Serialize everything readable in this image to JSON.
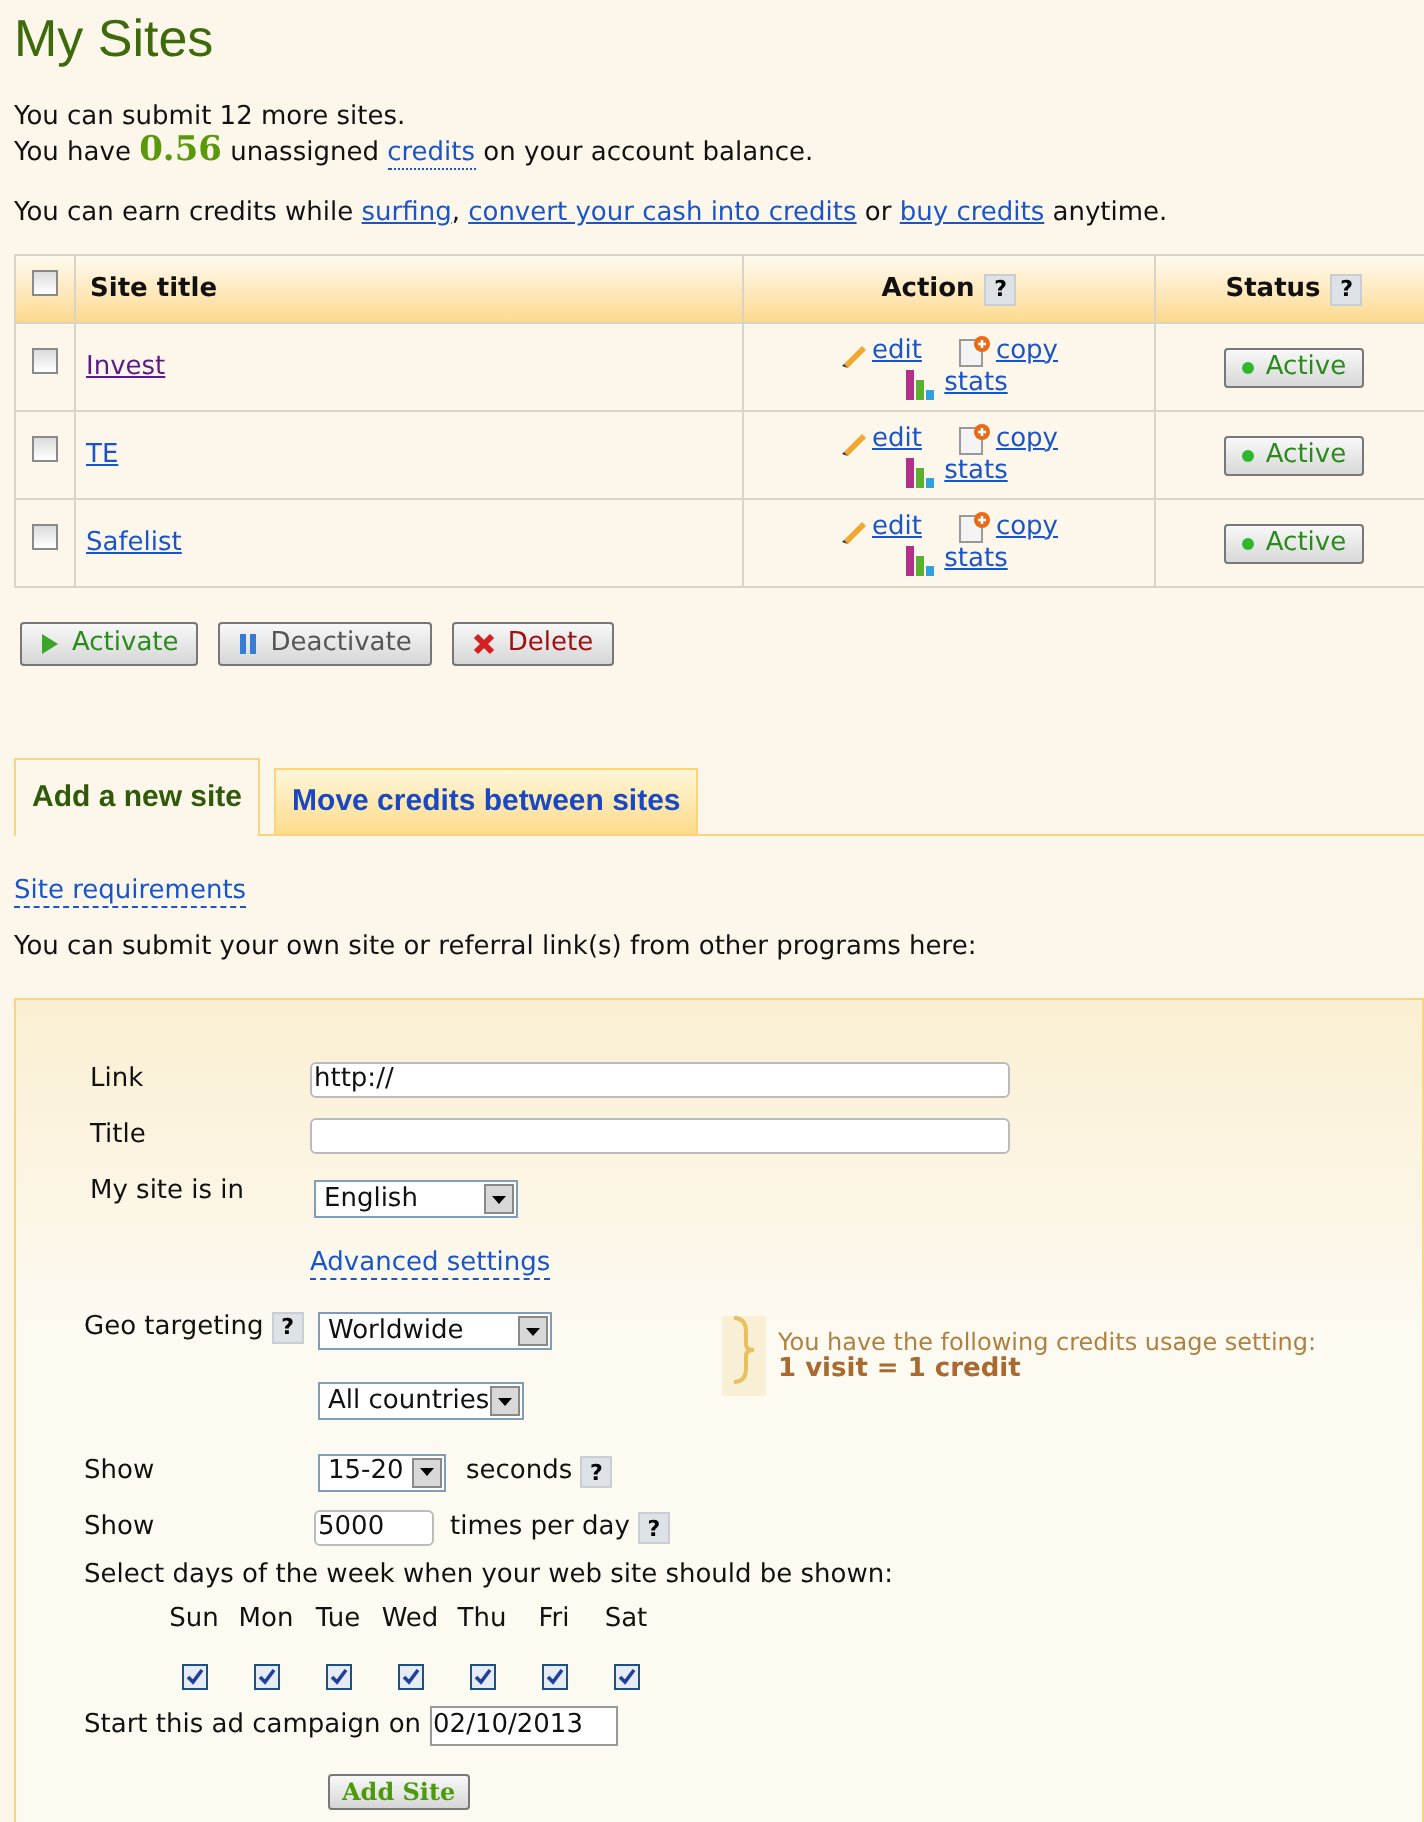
{
  "title": "My Sites",
  "intro": [
    [
      {
        "kind": "text",
        "text": "You can submit 12 more sites."
      }
    ],
    [
      {
        "kind": "text",
        "text": "You have "
      },
      {
        "kind": "amount",
        "text": "0.56"
      },
      {
        "kind": "text",
        "text": " unassigned "
      },
      {
        "kind": "dotted_link",
        "text": "credits"
      },
      {
        "kind": "text",
        "text": " on your account balance."
      }
    ]
  ],
  "earn": [
    {
      "kind": "text",
      "text": "You can earn credits while "
    },
    {
      "kind": "link",
      "text": "surfing"
    },
    {
      "kind": "text",
      "text": ", "
    },
    {
      "kind": "link",
      "text": "convert your cash into credits"
    },
    {
      "kind": "text",
      "text": " or "
    },
    {
      "kind": "link",
      "text": "buy credits"
    },
    {
      "kind": "text",
      "text": " anytime."
    }
  ],
  "table": {
    "select_all": {
      "checked": false
    },
    "columns": [
      {
        "label": "Site title"
      },
      {
        "label": "Action",
        "help": "?"
      },
      {
        "label": "Status",
        "help": "?"
      }
    ],
    "rows": [
      {
        "checked": false,
        "title": "Invest",
        "visited": true,
        "edit": "edit",
        "copy": "copy",
        "stats": "stats",
        "status": "Active"
      },
      {
        "checked": false,
        "title": "TE",
        "visited": false,
        "edit": "edit",
        "copy": "copy",
        "stats": "stats",
        "status": "Active"
      },
      {
        "checked": false,
        "title": "Safelist",
        "visited": false,
        "edit": "edit",
        "copy": "copy",
        "stats": "stats",
        "status": "Active"
      }
    ]
  },
  "bulk_buttons": [
    {
      "kind": "activate",
      "label": "Activate"
    },
    {
      "kind": "deactivate",
      "label": "Deactivate"
    },
    {
      "kind": "delete",
      "label": "Delete"
    }
  ],
  "tabs": [
    {
      "label": "Add a new site",
      "selected": true
    },
    {
      "label": "Move credits between sites",
      "selected": false
    }
  ],
  "requirements_link": "Site requirements",
  "description": "You can submit your own site or referral link(s) from other programs here:",
  "form": {
    "link": {
      "label": "Link",
      "value": "http://"
    },
    "title": {
      "label": "Title"
    },
    "language": {
      "label": "My site is in",
      "value": "English"
    },
    "advanced_link": "Advanced settings",
    "geo": {
      "label": "Geo targeting",
      "help": "?",
      "value": "Worldwide",
      "countries": "All countries"
    },
    "note": {
      "text": "You have the following credits usage setting:",
      "value": "1 visit = 1 credit"
    },
    "duration": {
      "label": "Show",
      "value": "15-20",
      "unit": "seconds",
      "help": "?"
    },
    "frequency": {
      "label": "Show",
      "value": "5000",
      "unit": "times per day",
      "help": "?"
    },
    "days_label": "Select days of the week when your web site should be shown:",
    "days": [
      {
        "label": "Sun",
        "checked": true
      },
      {
        "label": "Mon",
        "checked": true
      },
      {
        "label": "Tue",
        "checked": true
      },
      {
        "label": "Wed",
        "checked": true
      },
      {
        "label": "Thu",
        "checked": true
      },
      {
        "label": "Fri",
        "checked": true
      },
      {
        "label": "Sat",
        "checked": true
      }
    ],
    "start": {
      "label": "Start this ad campaign on",
      "value": "02/10/2013"
    },
    "submit": "Add Site"
  }
}
